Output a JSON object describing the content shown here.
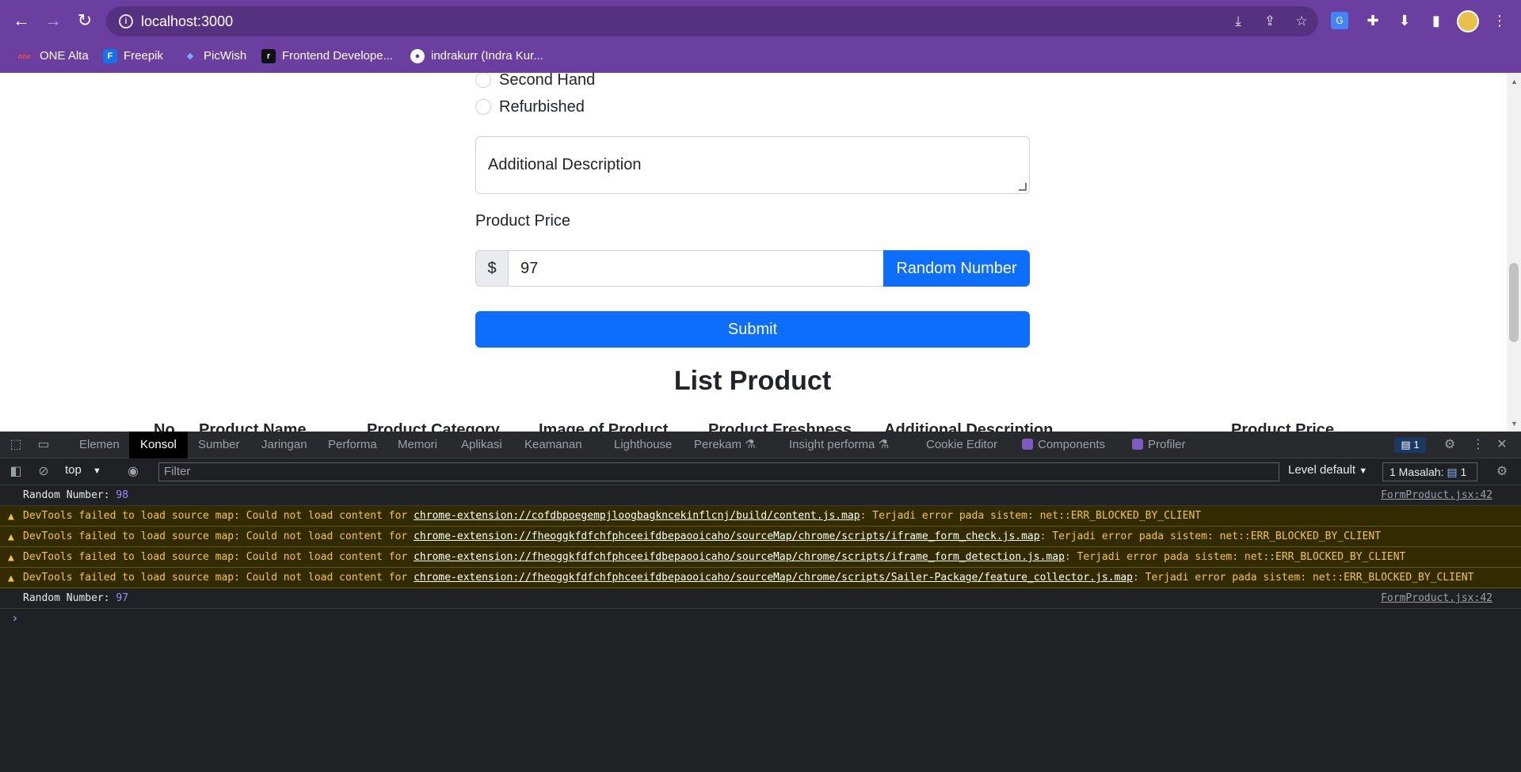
{
  "browser": {
    "url": "localhost:3000",
    "bookmarks": [
      {
        "label": "ONE Alta",
        "icon": "one-alta-favicon",
        "color": "#c0392b"
      },
      {
        "label": "Freepik",
        "icon": "freepik-favicon",
        "color": "#1273eb"
      },
      {
        "label": "PicWish",
        "icon": "picwish-favicon",
        "color": "#4a7dff"
      },
      {
        "label": "Frontend Develope...",
        "icon": "roadmap-favicon",
        "color": "#111111"
      },
      {
        "label": "indrakurr (Indra Kur...",
        "icon": "github-icon",
        "color": "#ffffff"
      }
    ]
  },
  "form": {
    "radio_second_hand": "Second Hand",
    "radio_refurbished": "Refurbished",
    "description_placeholder": "Additional Description",
    "price_label": "Product Price",
    "currency": "$",
    "price_value": "97",
    "random_button": "Random Number",
    "submit_button": "Submit"
  },
  "list": {
    "title": "List Product",
    "columns": [
      "No",
      "Product Name",
      "Product Category",
      "Image of Product",
      "Product Freshness",
      "Additional Description",
      "Product Price"
    ]
  },
  "devtools": {
    "tabs": [
      "Elemen",
      "Konsol",
      "Sumber",
      "Jaringan",
      "Performa",
      "Memori",
      "Aplikasi",
      "Keamanan",
      "Lighthouse",
      "Perekam",
      "Insight performa",
      "Cookie Editor",
      "Components",
      "Profiler"
    ],
    "issue_count": "1",
    "context": "top",
    "filter_placeholder": "Filter",
    "level": "Level default",
    "issues_label": "1 Masalah:",
    "issues_count": "1",
    "messages": [
      {
        "type": "log",
        "prefix": "Random Number: ",
        "value": "98",
        "source": "FormProduct.jsx:42"
      },
      {
        "type": "warn",
        "prefix": "DevTools failed to load source map: Could not load content for ",
        "link": "chrome-extension://cofdbpoegempjloogbagkncekinflcnj/build/content.js.map",
        "suffix": ": Terjadi error pada sistem: net::ERR_BLOCKED_BY_CLIENT"
      },
      {
        "type": "warn",
        "prefix": "DevTools failed to load source map: Could not load content for ",
        "link": "chrome-extension://fheoggkfdfchfphceeifdbepaooicaho/sourceMap/chrome/scripts/iframe_form_check.js.map",
        "suffix": ": Terjadi error pada sistem: net::ERR_BLOCKED_BY_CLIENT"
      },
      {
        "type": "warn",
        "prefix": "DevTools failed to load source map: Could not load content for ",
        "link": "chrome-extension://fheoggkfdfchfphceeifdbepaooicaho/sourceMap/chrome/scripts/iframe_form_detection.js.map",
        "suffix": ": Terjadi error pada sistem: net::ERR_BLOCKED_BY_CLIENT"
      },
      {
        "type": "warn",
        "prefix": "DevTools failed to load source map: Could not load content for ",
        "link": "chrome-extension://fheoggkfdfchfphceeifdbepaooicaho/sourceMap/chrome/scripts/Sailer-Package/feature_collector.js.map",
        "suffix": ": Terjadi error pada sistem: net::ERR_BLOCKED_BY_CLIENT"
      },
      {
        "type": "log",
        "prefix": "Random Number: ",
        "value": "97",
        "source": "FormProduct.jsx:42"
      }
    ]
  }
}
